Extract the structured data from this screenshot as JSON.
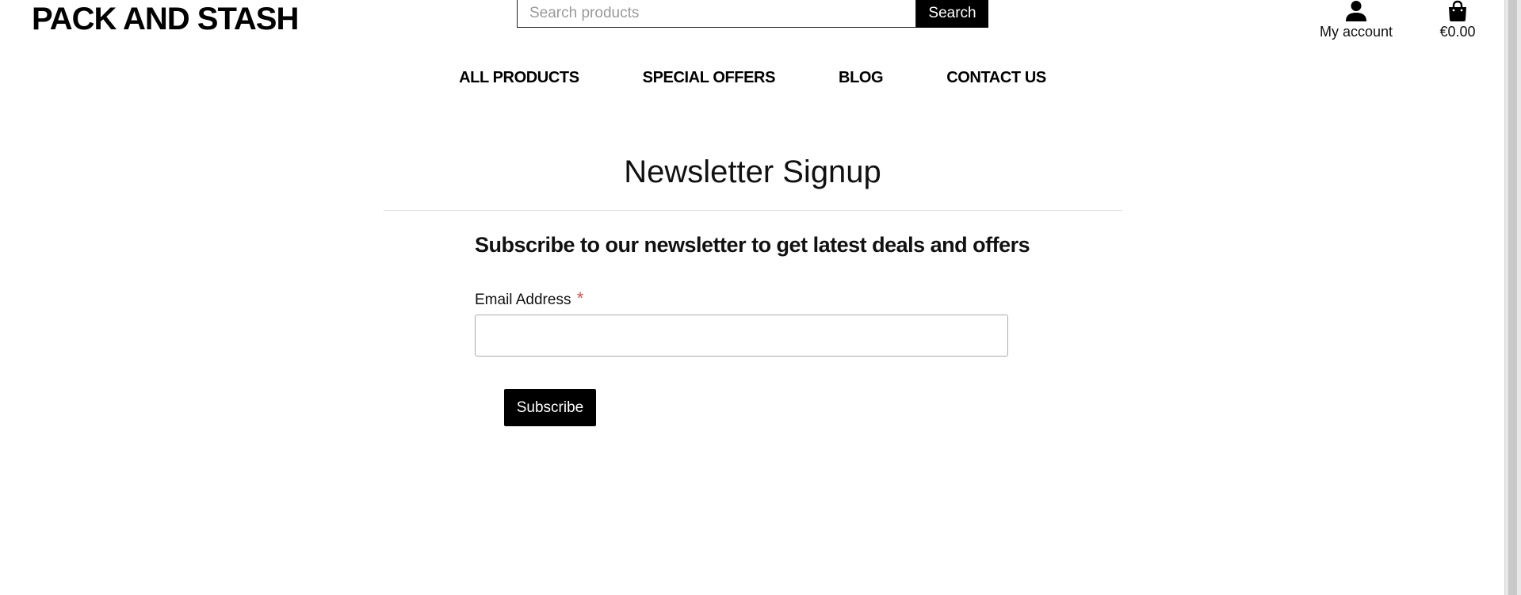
{
  "header": {
    "brand": "PACK AND STASH",
    "search": {
      "placeholder": "Search products",
      "value": "",
      "button_label": "Search"
    },
    "account": {
      "label": "My account",
      "icon": "user-icon"
    },
    "basket": {
      "total": "€0.00",
      "icon": "shopping-bag-icon"
    }
  },
  "nav": {
    "items": [
      {
        "label": "ALL PRODUCTS"
      },
      {
        "label": "SPECIAL OFFERS"
      },
      {
        "label": "BLOG"
      },
      {
        "label": "CONTACT US"
      }
    ]
  },
  "main": {
    "title": "Newsletter Signup",
    "subheading": "Subscribe to our newsletter to get latest deals and offers",
    "form": {
      "email_label": "Email Address",
      "required_marker": "*",
      "email_value": "",
      "submit_label": "Subscribe"
    }
  },
  "colors": {
    "primary": "#000000",
    "required": "#d9534f",
    "background": "#ffffff"
  }
}
